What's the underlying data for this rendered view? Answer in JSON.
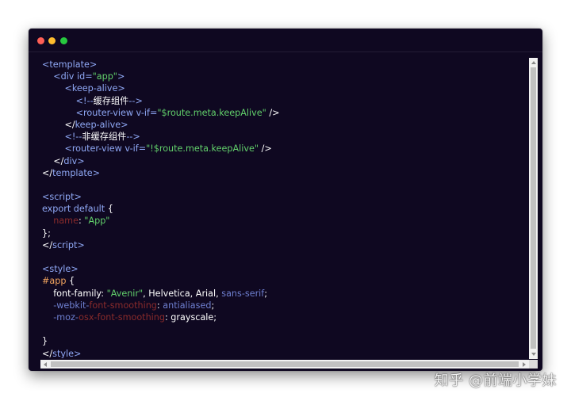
{
  "window": {
    "traffic_lights": [
      "close",
      "minimize",
      "maximize"
    ],
    "colors": {
      "background": "#0f0821",
      "close": "#ff5f56",
      "minimize": "#ffbd2e",
      "maximize": "#27c93f",
      "tag": "#8fa8f5",
      "string": "#62d06b",
      "property_muted": "#8a2b2b",
      "selector": "#f0a35e"
    }
  },
  "code": {
    "lines": [
      [
        {
          "t": "<template>",
          "c": "tag"
        }
      ],
      [
        {
          "t": "    <div ",
          "c": "tag"
        },
        {
          "t": "id=",
          "c": "attr"
        },
        {
          "t": "\"app\"",
          "c": "str"
        },
        {
          "t": ">",
          "c": "tag"
        }
      ],
      [
        {
          "t": "        <keep-alive>",
          "c": "tag"
        }
      ],
      [
        {
          "t": "            <!--",
          "c": "comment"
        },
        {
          "t": "缓存组件",
          "c": "cjk"
        },
        {
          "t": "-->",
          "c": "comment"
        }
      ],
      [
        {
          "t": "            <router-view ",
          "c": "tag"
        },
        {
          "t": "v-if=",
          "c": "attr"
        },
        {
          "t": "\"$route.meta.keepAlive\"",
          "c": "str"
        },
        {
          "t": " />",
          "c": "plain"
        }
      ],
      [
        {
          "t": "        </",
          "c": "plain"
        },
        {
          "t": "keep-alive",
          "c": "tag"
        },
        {
          "t": ">",
          "c": "tag"
        }
      ],
      [
        {
          "t": "        <!--",
          "c": "comment"
        },
        {
          "t": "非缓存组件",
          "c": "cjk"
        },
        {
          "t": "-->",
          "c": "comment"
        }
      ],
      [
        {
          "t": "        <router-view ",
          "c": "tag"
        },
        {
          "t": "v-if=",
          "c": "attr"
        },
        {
          "t": "\"!$route.meta.keepAlive\"",
          "c": "str"
        },
        {
          "t": " />",
          "c": "plain"
        }
      ],
      [
        {
          "t": "    </",
          "c": "plain"
        },
        {
          "t": "div",
          "c": "tag"
        },
        {
          "t": ">",
          "c": "tag"
        }
      ],
      [
        {
          "t": "</",
          "c": "plain"
        },
        {
          "t": "template",
          "c": "tag"
        },
        {
          "t": ">",
          "c": "tag"
        }
      ],
      [
        {
          "t": "",
          "c": "plain"
        }
      ],
      [
        {
          "t": "<script>",
          "c": "tag"
        }
      ],
      [
        {
          "t": "export default",
          "c": "kw"
        },
        {
          "t": " {",
          "c": "plain"
        }
      ],
      [
        {
          "t": "    ",
          "c": "plain"
        },
        {
          "t": "name",
          "c": "prop-red"
        },
        {
          "t": ": ",
          "c": "plain"
        },
        {
          "t": "\"App\"",
          "c": "str"
        }
      ],
      [
        {
          "t": "};",
          "c": "plain"
        }
      ],
      [
        {
          "t": "</",
          "c": "plain"
        },
        {
          "t": "script",
          "c": "tag"
        },
        {
          "t": ">",
          "c": "tag"
        }
      ],
      [
        {
          "t": "",
          "c": "plain"
        }
      ],
      [
        {
          "t": "<style>",
          "c": "tag"
        }
      ],
      [
        {
          "t": "#app",
          "c": "sel"
        },
        {
          "t": " {",
          "c": "plain"
        }
      ],
      [
        {
          "t": "    font-family: ",
          "c": "plain"
        },
        {
          "t": "\"Avenir\"",
          "c": "str"
        },
        {
          "t": ", Helvetica, Arial, ",
          "c": "plain"
        },
        {
          "t": "sans-serif",
          "c": "val-blue"
        },
        {
          "t": ";",
          "c": "plain"
        }
      ],
      [
        {
          "t": "    ",
          "c": "plain"
        },
        {
          "t": "-webkit-",
          "c": "prefix"
        },
        {
          "t": "font-smoothing",
          "c": "prop-red"
        },
        {
          "t": ": ",
          "c": "plain"
        },
        {
          "t": "antialiased",
          "c": "val-blue"
        },
        {
          "t": ";",
          "c": "plain"
        }
      ],
      [
        {
          "t": "    ",
          "c": "plain"
        },
        {
          "t": "-moz-",
          "c": "prefix"
        },
        {
          "t": "osx-font-smoothing",
          "c": "prop-red"
        },
        {
          "t": ": grayscale;",
          "c": "plain"
        }
      ],
      [
        {
          "t": "",
          "c": "plain"
        }
      ],
      [
        {
          "t": "}",
          "c": "plain"
        }
      ],
      [
        {
          "t": "</",
          "c": "plain"
        },
        {
          "t": "style",
          "c": "tag"
        },
        {
          "t": ">",
          "c": "tag"
        }
      ]
    ]
  },
  "watermark": {
    "text": "知乎 @前端小学妹"
  }
}
